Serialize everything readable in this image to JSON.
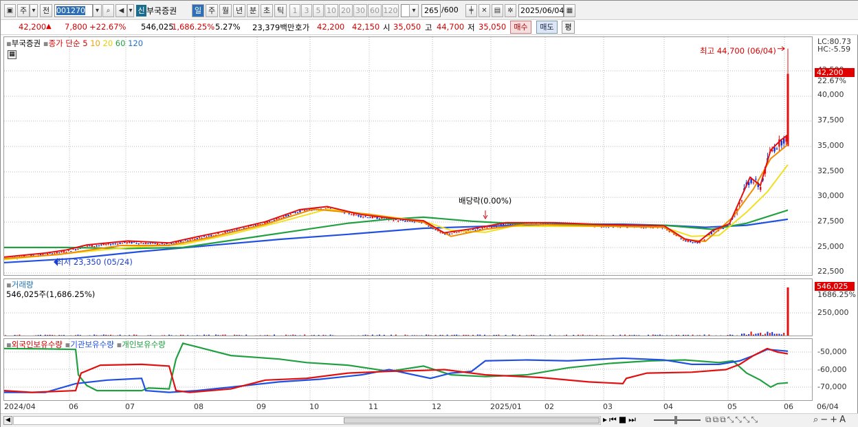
{
  "toolbar": {
    "market_btn": "주",
    "prev_btn": "전",
    "code": "001270",
    "type_badge": "신",
    "name": "부국증권",
    "periods": [
      "일",
      "주",
      "월",
      "년",
      "분",
      "초",
      "틱"
    ],
    "nums": [
      "1",
      "3",
      "5",
      "10",
      "20",
      "30",
      "60",
      "120"
    ],
    "count": "265",
    "count_max": "/600",
    "date": "2025/06/04"
  },
  "quote": {
    "price": "42,200",
    "arrow": "▲",
    "change": "7,800",
    "pct": "+22.67%",
    "volume": "546,025",
    "vol_pct": "1,686.25%",
    "turnover": "5.27%",
    "amount": "23,379백만",
    "ask_label": "호가",
    "ask1": "42,200",
    "ask2": "42,150",
    "open_label": "시",
    "open": "35,050",
    "high_label": "고",
    "high": "44,700",
    "low_label": "저",
    "low": "35,050",
    "buy": "매수",
    "sell": "매도",
    "eval": "평"
  },
  "price_panel": {
    "name": "부국증권",
    "legend_prefix": "종가 단순",
    "ma": [
      "5",
      "10",
      "20",
      "60",
      "120"
    ],
    "lc": "LC:80.73",
    "hc": "HC:-5.59",
    "high_note": "최고 44,700 (06/04)",
    "low_note": "최저 23,350 (05/24)",
    "div_note": "배당락(0.00%)",
    "last_price": "42,200",
    "last_pct": "22.67%",
    "y_ticks": [
      "42,500",
      "40,000",
      "37,500",
      "35,000",
      "32,500",
      "30,000",
      "27,500",
      "25,000",
      "22,500"
    ]
  },
  "volume_panel": {
    "title": "거래량",
    "value": "546,025주(1,686.25%)",
    "last": "546,025",
    "last_pct": "1686.25%",
    "y_ticks": [
      "250,000"
    ]
  },
  "holding_panel": {
    "legend": [
      "외국인보유수량",
      "기관보유수량",
      "개인보유수량"
    ],
    "y_ticks": [
      "-50,000",
      "-60,000",
      "-70,000"
    ]
  },
  "x_labels": [
    "2024/04",
    "06",
    "07",
    "08",
    "09",
    "10",
    "11",
    "12",
    "2025/01",
    "02",
    "03",
    "04",
    "05",
    "06",
    "06/04"
  ],
  "colors": {
    "ma5": "#e01010",
    "ma10": "#f08c00",
    "ma20": "#f0e020",
    "ma60": "#20a040",
    "ma120": "#2050e0",
    "up": "#e01010",
    "down": "#1030d0"
  }
}
